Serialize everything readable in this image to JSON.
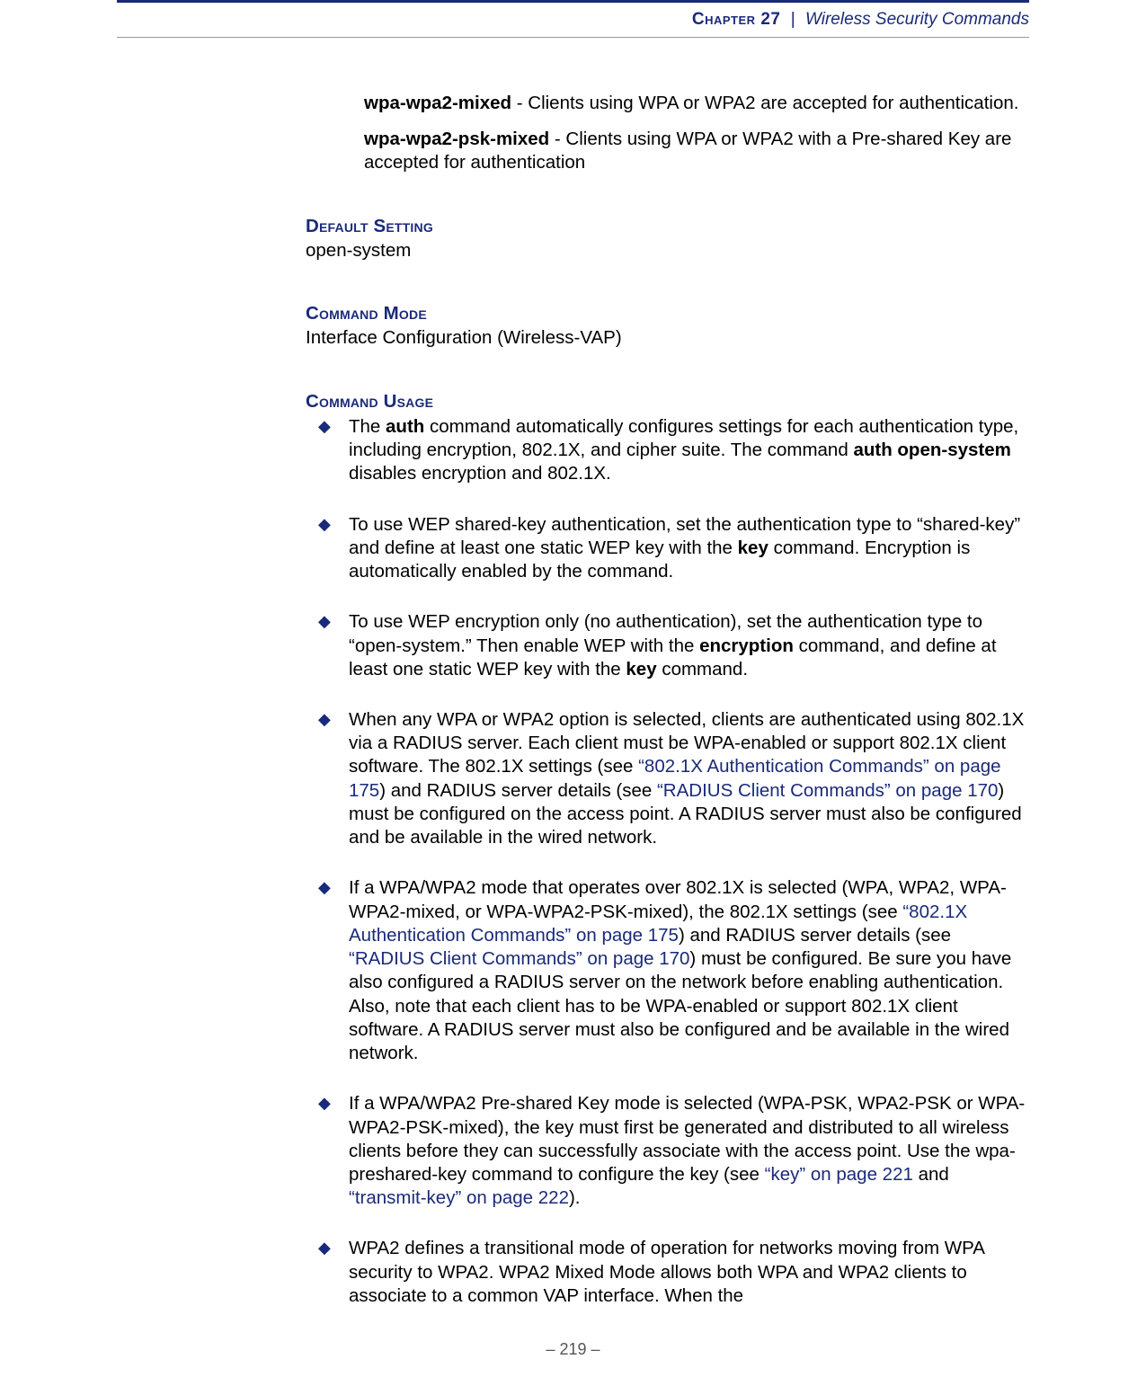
{
  "header": {
    "chapter_word": "Chapter",
    "chapter_num": "27",
    "separator": "|",
    "title": "Wireless Security Commands"
  },
  "options": {
    "opt1": {
      "label": "wpa-wpa2-mixed",
      "dash": " - ",
      "text": "Clients using WPA or WPA2 are accepted for authentication."
    },
    "opt2": {
      "label": "wpa-wpa2-psk-mixed",
      "dash": " - ",
      "text": "Clients using WPA or WPA2 with a Pre-shared Key are accepted for authentication"
    }
  },
  "sections": {
    "default_setting": {
      "heading": "Default Setting",
      "body": "open-system"
    },
    "command_mode": {
      "heading": "Command Mode",
      "body": "Interface Configuration (Wireless-VAP)"
    },
    "command_usage": {
      "heading": "Command Usage"
    }
  },
  "usage": {
    "b1": {
      "t1": "The ",
      "b1": "auth",
      "t2": " command automatically configures settings for each authentication type, including encryption, 802.1X, and cipher suite. The command ",
      "b2": "auth open-system",
      "t3": " disables encryption and 802.1X."
    },
    "b2": {
      "t1": "To use WEP shared-key authentication, set the authentication type to “shared-key” and define at least one static WEP key with the ",
      "b1": "key",
      "t2": " command. Encryption is automatically enabled by the command."
    },
    "b3": {
      "t1": "To use WEP encryption only (no authentication), set the authentication type to “open-system.” Then enable WEP with the ",
      "b1": "encryption",
      "t2": " command, and define at least one static WEP key with the ",
      "b2": "key",
      "t3": " command."
    },
    "b4": {
      "t1": "When any WPA or WPA2 option is selected, clients are authenticated using 802.1X via a RADIUS server. Each client must be WPA-enabled or support 802.1X client software. The 802.1X settings (see ",
      "l1": "“802.1X Authentication Commands” on page 175",
      "t2": ") and RADIUS server details (see ",
      "l2": "“RADIUS Client Commands” on page 170",
      "t3": ") must be configured on the access point. A RADIUS server must also be configured and be available in the wired network."
    },
    "b5": {
      "t1": "If a WPA/WPA2 mode that operates over 802.1X is selected (WPA, WPA2, WPA-WPA2-mixed, or WPA-WPA2-PSK-mixed), the 802.1X settings (see ",
      "l1": "“802.1X Authentication Commands” on page 175",
      "t2": ") and RADIUS server details (see ",
      "l2": "“RADIUS Client Commands” on page 170",
      "t3": ") must be configured. Be sure you have also configured a RADIUS server on the network before enabling authentication. Also, note that each client has to be WPA-enabled or support 802.1X client software. A RADIUS server must also be configured and be available in the wired network."
    },
    "b6": {
      "t1": "If a WPA/WPA2 Pre-shared Key mode is selected (WPA-PSK, WPA2-PSK or WPA-WPA2-PSK-mixed), the key must first be generated and distributed to all wireless clients before they can successfully associate with the access point. Use the wpa-preshared-key command to configure the key (see ",
      "l1": "“key” on page 221",
      "t2": " and ",
      "l2": "“transmit-key” on page 222",
      "t3": ")."
    },
    "b7": {
      "t1": "WPA2 defines a transitional mode of operation for networks moving from WPA security to WPA2. WPA2 Mixed Mode allows both WPA and WPA2 clients to associate to a common VAP interface. When the"
    }
  },
  "footer": {
    "dash_left": "–  ",
    "page": "219",
    "dash_right": "  –"
  }
}
